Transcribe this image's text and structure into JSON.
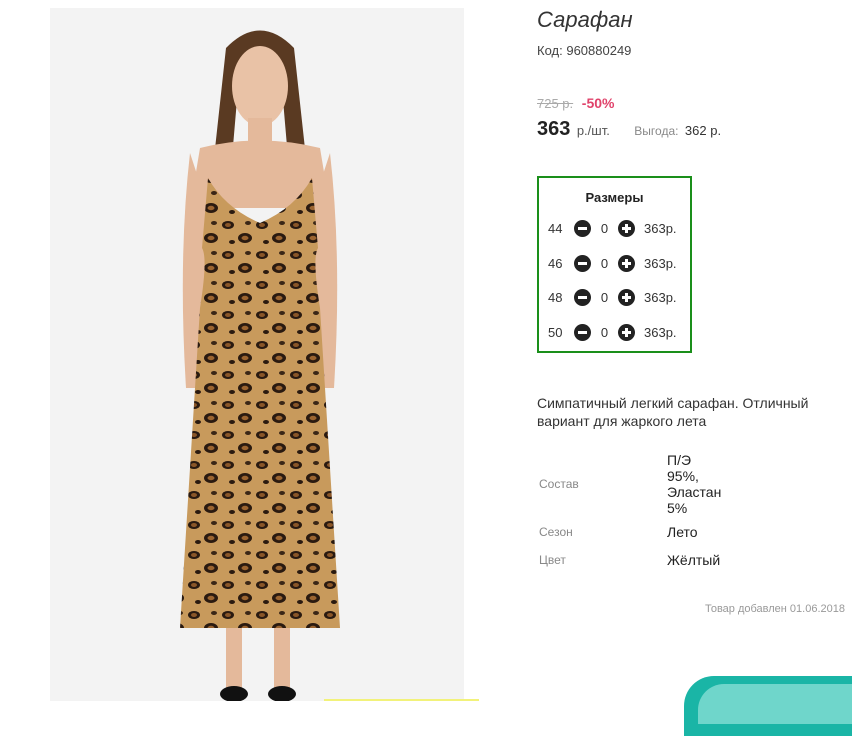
{
  "product": {
    "title": "Сарафан",
    "sku_label": "Код:",
    "sku": "960880249",
    "old_price": "725 р.",
    "discount": "-50%",
    "price": "363",
    "price_unit": "р./шт.",
    "saving_label": "Выгода:",
    "saving_value": "362 р."
  },
  "sizes": {
    "title": "Размеры",
    "rows": [
      {
        "size": "44",
        "qty": "0",
        "price": "363р."
      },
      {
        "size": "46",
        "qty": "0",
        "price": "363р."
      },
      {
        "size": "48",
        "qty": "0",
        "price": "363р."
      },
      {
        "size": "50",
        "qty": "0",
        "price": "363р."
      }
    ]
  },
  "description": "Симпатичный легкий сарафан. Отличный вариант для жаркого лета",
  "attributes": [
    {
      "label": "Состав",
      "value_lines": [
        "П/Э",
        "95%,",
        "Эластан",
        "5%"
      ]
    },
    {
      "label": "Сезон",
      "value": "Лето"
    },
    {
      "label": "Цвет",
      "value": "Жёлтый"
    }
  ],
  "added_text": "Товар добавлен 01.06.2018",
  "icons": {
    "minus": "minus-circle-icon",
    "plus": "plus-circle-icon"
  },
  "colors": {
    "discount": "#e0436b",
    "sizes_border": "#1a8f1a",
    "chat_widget": "#1ab5a6"
  }
}
